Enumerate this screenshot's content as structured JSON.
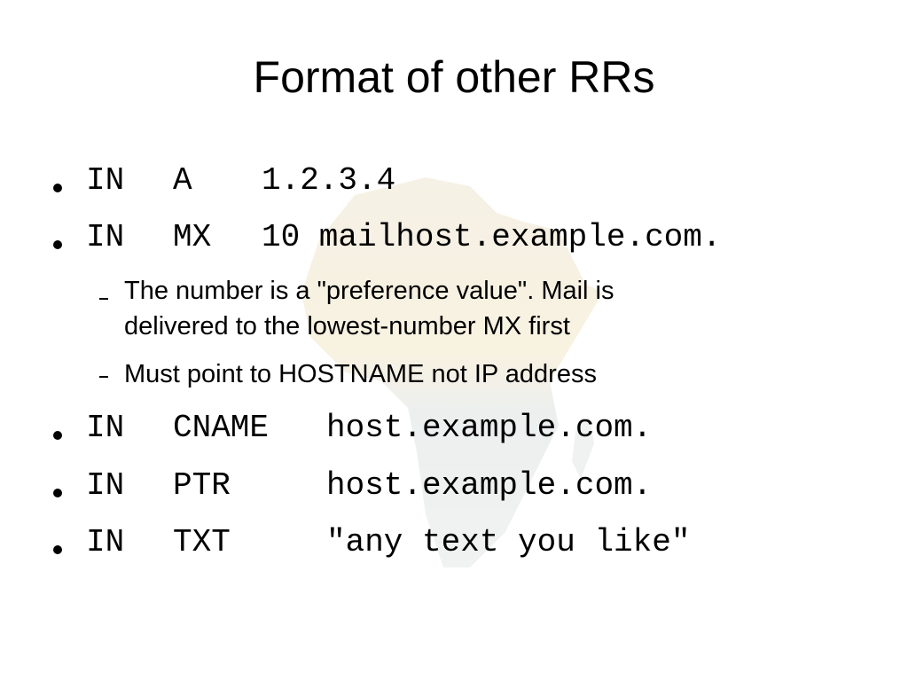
{
  "slide": {
    "title": "Format of other RRs",
    "records": [
      {
        "class": "IN",
        "type": "A",
        "value": "1.2.3.4"
      },
      {
        "class": "IN",
        "type": "MX",
        "value": "10 mailhost.example.com."
      },
      {
        "class": "IN",
        "type": "CNAME",
        "value": "host.example.com."
      },
      {
        "class": "IN",
        "type": "PTR",
        "value": "host.example.com."
      },
      {
        "class": "IN",
        "type": "TXT",
        "value": "\"any text you like\""
      }
    ],
    "mx_notes": [
      {
        "line1": "The number is a \"preference value\". Mail is",
        "line2": "delivered to the lowest-number MX first"
      },
      {
        "line1": "Must point to HOSTNAME not IP address"
      }
    ]
  }
}
